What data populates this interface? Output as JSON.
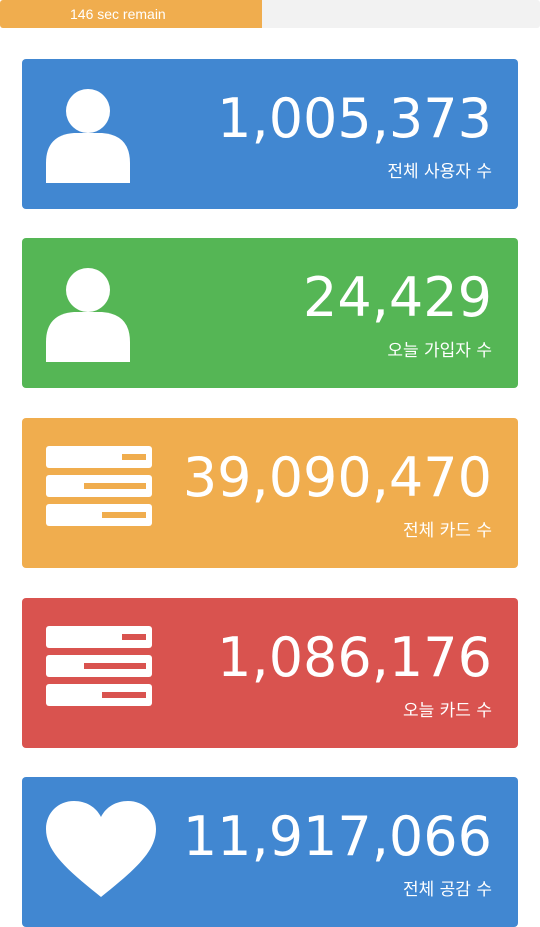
{
  "progress": {
    "text": "146 sec remain",
    "fraction": 0.486,
    "fill_color": "#f0ad4e",
    "track_color": "#f2f2f2"
  },
  "cards": [
    {
      "value": "1,005,373",
      "label": "전체 사용자 수",
      "icon": "user-icon",
      "color": "#4187d1"
    },
    {
      "value": "24,429",
      "label": "오늘 가입자 수",
      "icon": "user-icon",
      "color": "#55b655"
    },
    {
      "value": "39,090,470",
      "label": "전체 카드 수",
      "icon": "server-icon",
      "color": "#f0ad4e"
    },
    {
      "value": "1,086,176",
      "label": "오늘 카드 수",
      "icon": "server-icon",
      "color": "#d9534f"
    },
    {
      "value": "11,917,066",
      "label": "전체 공감 수",
      "icon": "heart-icon",
      "color": "#4187d1"
    }
  ]
}
